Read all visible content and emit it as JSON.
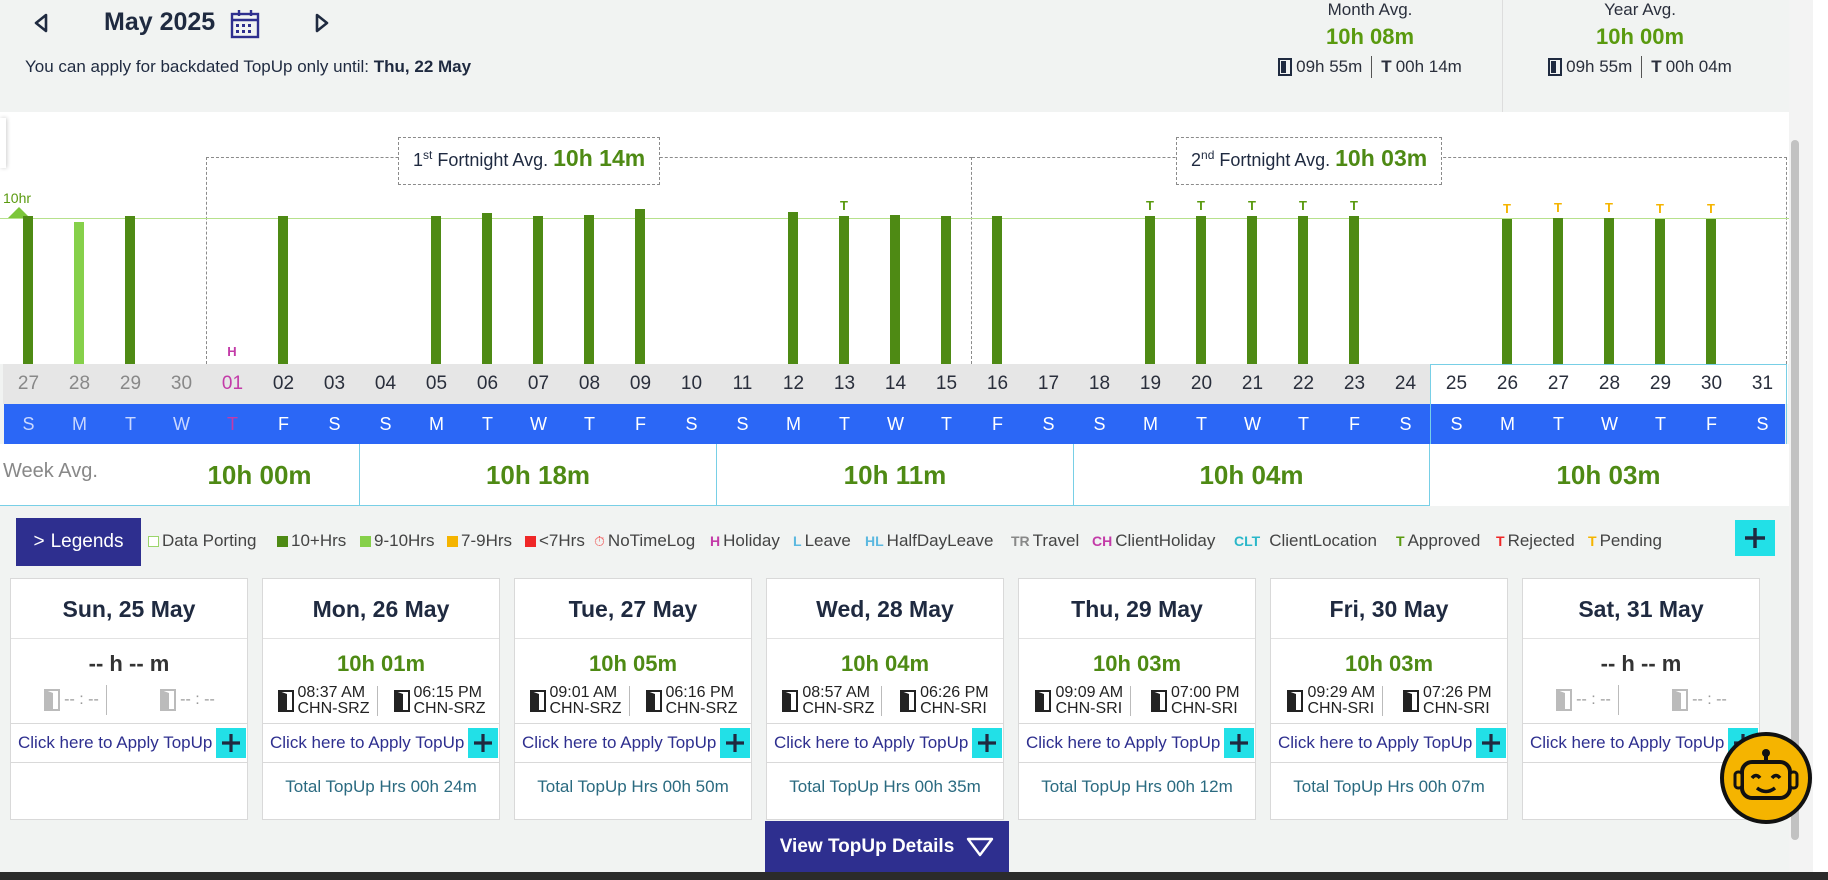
{
  "header": {
    "month_title": "May 2025",
    "backdated_text": "You can apply for backdated TopUp only until:",
    "backdated_date": "Thu, 22 May",
    "icons": {
      "prev": "caret-left-icon",
      "next": "caret-right-icon",
      "calendar": "calendar-icon"
    }
  },
  "month_avg": {
    "title": "Month Avg.",
    "value": "10h 08m",
    "office": "09h 55m",
    "topup_prefix": "T",
    "topup": "00h 14m"
  },
  "year_avg": {
    "title": "Year Avg.",
    "value": "10h 00m",
    "office": "09h 55m",
    "topup_prefix": "T",
    "topup": "00h 04m"
  },
  "fortnight1": {
    "sup": "st",
    "prefix": "1",
    "label": "Fortnight Avg.",
    "value": "10h 14m"
  },
  "fortnight2": {
    "sup": "nd",
    "prefix": "2",
    "label": "Fortnight Avg.",
    "value": "10h 03m"
  },
  "chart_data": {
    "type": "bar",
    "reference_label": "10hr",
    "reference_value": 10,
    "categories": [
      "27",
      "28",
      "29",
      "30",
      "01",
      "02",
      "03",
      "04",
      "05",
      "06",
      "07",
      "08",
      "09",
      "10",
      "11",
      "12",
      "13",
      "14",
      "15",
      "16",
      "17",
      "18",
      "19",
      "20",
      "21",
      "22",
      "23",
      "24",
      "25",
      "26",
      "27",
      "28",
      "29",
      "30",
      "31"
    ],
    "values": [
      10.2,
      9.8,
      10.2,
      0,
      0,
      10.2,
      0,
      0,
      10.2,
      10.4,
      10.2,
      10.3,
      10.7,
      0,
      0,
      10.5,
      10.2,
      10.3,
      10.2,
      10.2,
      0,
      0,
      10.2,
      10.2,
      10.2,
      10.2,
      10.2,
      0,
      0,
      10.0,
      10.1,
      10.1,
      10.0,
      10.0,
      0
    ],
    "bar_status": [
      "10+",
      "9-10",
      "10+",
      "",
      "",
      "10+",
      "",
      "",
      "10+",
      "10+",
      "10+",
      "10+",
      "10+",
      "",
      "",
      "10+",
      "10+",
      "10+",
      "10+",
      "10+",
      "",
      "",
      "10+",
      "10+",
      "10+",
      "10+",
      "10+",
      "",
      "",
      "10+",
      "10+",
      "10+",
      "10+",
      "10+",
      ""
    ],
    "marks": [
      "",
      "",
      "",
      "",
      "H",
      "",
      "",
      "",
      "",
      "",
      "",
      "",
      "",
      "",
      "",
      "",
      "T",
      "",
      "",
      "",
      "",
      "",
      "T",
      "T",
      "T",
      "T",
      "T",
      "",
      "",
      "T",
      "T",
      "T",
      "T",
      "T",
      ""
    ],
    "mark_colors": [
      "",
      "",
      "",
      "",
      "#c33ba8",
      "",
      "",
      "",
      "",
      "",
      "",
      "",
      "",
      "",
      "",
      "",
      "#5a9a0f",
      "",
      "",
      "",
      "",
      "",
      "#5a9a0f",
      "#5a9a0f",
      "#5a9a0f",
      "#5a9a0f",
      "#5a9a0f",
      "",
      "",
      "#f5b400",
      "#f5b400",
      "#f5b400",
      "#f5b400",
      "#f5b400",
      ""
    ],
    "weekdays": [
      "S",
      "M",
      "T",
      "W",
      "T",
      "F",
      "S",
      "S",
      "M",
      "T",
      "W",
      "T",
      "F",
      "S",
      "S",
      "M",
      "T",
      "W",
      "T",
      "F",
      "S",
      "S",
      "M",
      "T",
      "W",
      "T",
      "F",
      "S",
      "S",
      "M",
      "T",
      "W",
      "T",
      "F",
      "S"
    ],
    "ylim": [
      0,
      11
    ]
  },
  "colors": {
    "ten_plus": "#4e8a14",
    "nine_ten": "#86d04a",
    "seven_nine": "#f5b400",
    "lt_seven": "#ef2727",
    "holiday": "#c33ba8",
    "primary": "#2b67f6",
    "navy": "#2e2f8f",
    "cyan": "#22e0e7"
  },
  "week_avg": {
    "label": "Week Avg.",
    "values": [
      "10h 00m",
      "10h 18m",
      "10h 11m",
      "10h 04m",
      "10h 03m"
    ]
  },
  "legends": {
    "button": "Legends",
    "items": [
      {
        "label": "Data Porting"
      },
      {
        "label": "10+Hrs"
      },
      {
        "label": "9-10Hrs"
      },
      {
        "label": "7-9Hrs"
      },
      {
        "label": "<7Hrs"
      },
      {
        "label": "NoTimeLog"
      },
      {
        "prefix": "H",
        "label": "Holiday"
      },
      {
        "prefix": "L",
        "label": "Leave"
      },
      {
        "prefix": "HL",
        "label": "HalfDayLeave"
      },
      {
        "prefix": "TR",
        "label": "Travel"
      },
      {
        "prefix": "CH",
        "label": "ClientHoliday"
      },
      {
        "prefix": "CLT",
        "label": "ClientLocation"
      },
      {
        "prefix": "T",
        "label": "Approved"
      },
      {
        "prefix": "T",
        "label": "Rejected"
      },
      {
        "prefix": "T",
        "label": "Pending"
      }
    ]
  },
  "days": [
    {
      "date": "Sun, 25 May",
      "duration": "-- h -- m",
      "in_time": "-- : --",
      "in_loc": "",
      "out_time": "-- : --",
      "out_loc": "",
      "topup": "Click here to Apply TopUp",
      "total": ""
    },
    {
      "date": "Mon, 26 May",
      "duration": "10h 01m",
      "in_time": "08:37 AM",
      "in_loc": "CHN-SRZ",
      "out_time": "06:15 PM",
      "out_loc": "CHN-SRZ",
      "topup": "Click here to Apply TopUp",
      "total": "Total TopUp Hrs 00h 24m"
    },
    {
      "date": "Tue, 27 May",
      "duration": "10h 05m",
      "in_time": "09:01 AM",
      "in_loc": "CHN-SRZ",
      "out_time": "06:16 PM",
      "out_loc": "CHN-SRZ",
      "topup": "Click here to Apply TopUp",
      "total": "Total TopUp Hrs 00h 50m"
    },
    {
      "date": "Wed, 28 May",
      "duration": "10h 04m",
      "in_time": "08:57 AM",
      "in_loc": "CHN-SRZ",
      "out_time": "06:26 PM",
      "out_loc": "CHN-SRI",
      "topup": "Click here to Apply TopUp",
      "total": "Total TopUp Hrs 00h 35m"
    },
    {
      "date": "Thu, 29 May",
      "duration": "10h 03m",
      "in_time": "09:09 AM",
      "in_loc": "CHN-SRI",
      "out_time": "07:00 PM",
      "out_loc": "CHN-SRI",
      "topup": "Click here to Apply TopUp",
      "total": "Total TopUp Hrs 00h 12m"
    },
    {
      "date": "Fri, 30 May",
      "duration": "10h 03m",
      "in_time": "09:29 AM",
      "in_loc": "CHN-SRI",
      "out_time": "07:26 PM",
      "out_loc": "CHN-SRI",
      "topup": "Click here to Apply TopUp",
      "total": "Total TopUp Hrs 00h 07m"
    },
    {
      "date": "Sat, 31 May",
      "duration": "-- h -- m",
      "in_time": "-- : --",
      "in_loc": "",
      "out_time": "-- : --",
      "out_loc": "",
      "topup": "Click here to Apply TopUp",
      "total": ""
    }
  ],
  "view_button": "View TopUp Details"
}
